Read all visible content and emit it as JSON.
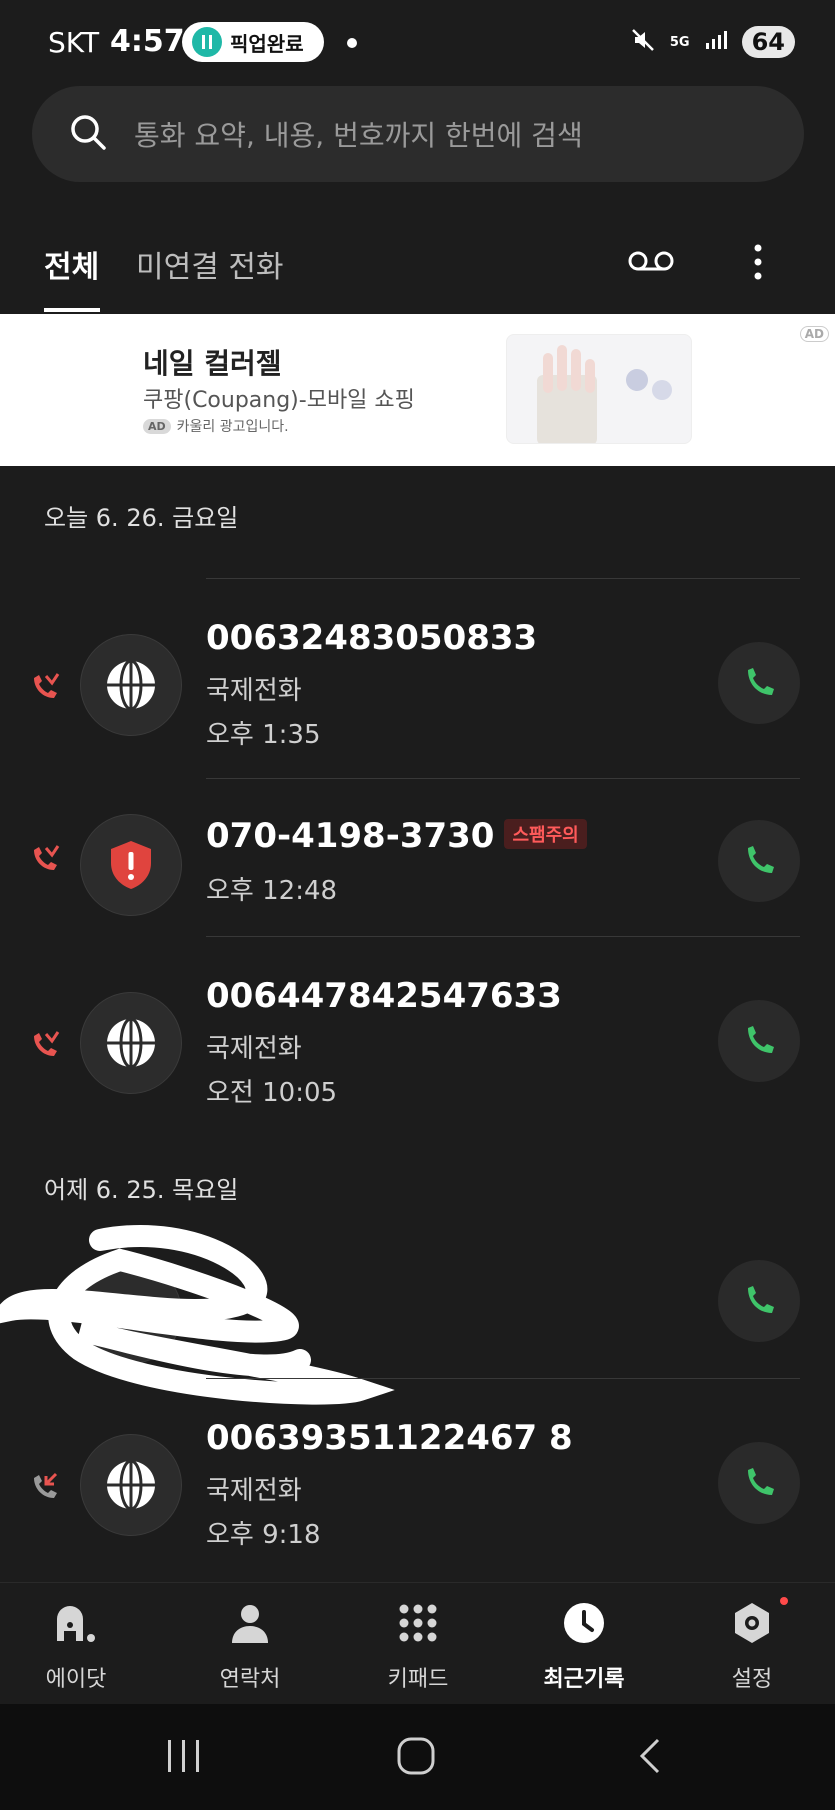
{
  "status_bar": {
    "carrier": "SKT",
    "time": "4:57",
    "pill_text": "픽업완료",
    "network": "5G",
    "battery": "64"
  },
  "search": {
    "placeholder": "통화 요약, 내용, 번호까지 한번에 검색"
  },
  "tabs": {
    "all": "전체",
    "missed": "미연결 전화"
  },
  "ad": {
    "title": "네일 컬러젤",
    "subtitle": "쿠팡(Coupang)-모바일 쇼핑",
    "badge": "AD",
    "footer": "카울리 광고입니다.",
    "corner_badge": "AD"
  },
  "sections": [
    {
      "header": "오늘 6. 26. 금요일"
    },
    {
      "header": "어제 6. 25. 목요일"
    }
  ],
  "calls": [
    {
      "number": "00632483050833",
      "label": "국제전화",
      "time": "오후 1:35",
      "type": "missed",
      "avatar": "globe-icon"
    },
    {
      "number": "070-4198-3730",
      "badge": "스팸주의",
      "time": "오후 12:48",
      "type": "missed",
      "avatar": "shield-alert-icon"
    },
    {
      "number": "00644784254763З",
      "label": "국제전화",
      "time": "오전 10:05",
      "type": "missed",
      "avatar": "globe-icon"
    },
    {
      "number": "",
      "type": "obscured"
    },
    {
      "number": "00639351122467 8",
      "label": "국제전화",
      "time": "오후 9:18",
      "type": "incoming-missed",
      "avatar": "globe-icon"
    }
  ],
  "bottom_nav": [
    {
      "label": "에이닷",
      "icon": "adot-icon"
    },
    {
      "label": "연락처",
      "icon": "person-icon"
    },
    {
      "label": "키패드",
      "icon": "keypad-icon"
    },
    {
      "label": "최근기록",
      "icon": "clock-icon",
      "active": true
    },
    {
      "label": "설정",
      "icon": "settings-icon"
    }
  ],
  "colors": {
    "missed": "#e85450",
    "call_green": "#3fc46a",
    "background": "#1c1c1c"
  }
}
